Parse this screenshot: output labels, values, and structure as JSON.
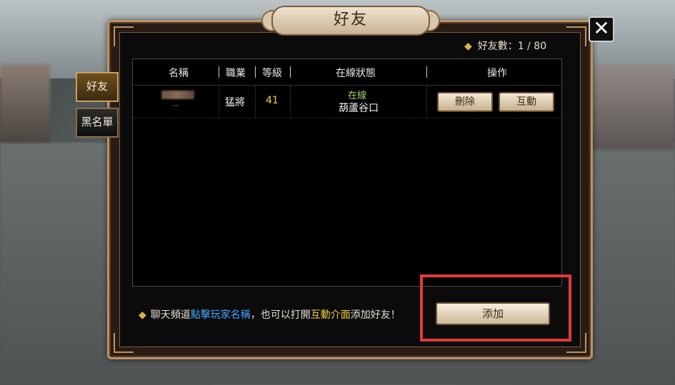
{
  "window": {
    "title": "好友"
  },
  "friend_count": {
    "label": "好友數：1 / 80"
  },
  "side_tabs": [
    {
      "label": "好友",
      "active": true
    },
    {
      "label": "黑名單",
      "active": false
    }
  ],
  "table": {
    "columns": [
      "名稱",
      "職業",
      "等級",
      "在線狀態",
      "操作"
    ],
    "rows": [
      {
        "name_sub": "--",
        "job": "猛將",
        "level": "41",
        "status": "在線",
        "location": "葫蘆谷口",
        "actions": [
          "刪除",
          "互動"
        ]
      }
    ]
  },
  "tip": {
    "prefix": "聊天頻道",
    "highlight1": "點擊玩家名稱",
    "mid": "，也可以打開",
    "highlight2": "互動介面",
    "suffix": "添加好友！"
  },
  "add_button": {
    "label": "添加"
  },
  "colors": {
    "highlight_box": "#e33a3a",
    "level_yellow": "#f2d23a",
    "online_green": "#a8d46a",
    "link_blue": "#46a6ff"
  },
  "icons": {
    "close": "close-icon",
    "bullet": "diamond-bullet-icon"
  }
}
